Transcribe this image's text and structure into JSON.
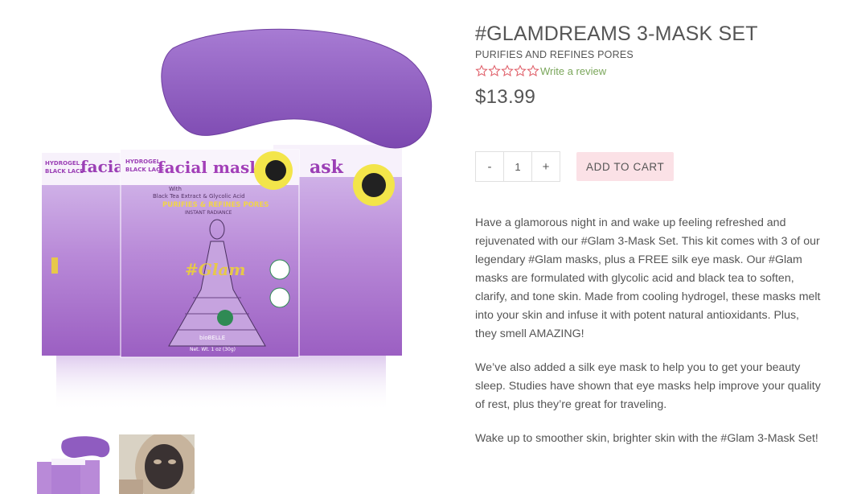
{
  "product": {
    "title": "#GLAMDREAMS 3-MASK SET",
    "subtitle": "PURIFIES AND REFINES PORES",
    "rating": {
      "stars": 0,
      "max": 5,
      "review_link": "Write a review"
    },
    "price": "$13.99",
    "quantity": "1",
    "qty_minus": "-",
    "qty_plus": "+",
    "add_to_cart": "ADD TO CART",
    "description": [
      "Have a glamorous night in and wake up feeling refreshed and rejuvenated with our #Glam 3-Mask Set. This kit comes with 3 of our legendary #Glam masks, plus a FREE silk eye mask. Our #Glam masks are formulated with glycolic acid and black tea to soften, clarify, and tone skin. Made from cooling hydrogel, these masks melt into your skin and infuse it with potent natural antioxidants. Plus, they smell AMAZING!",
      "We’ve also added a silk eye mask to help you to get your beauty sleep. Studies have shown that eye masks help improve your quality of rest, plus they’re great for traveling.",
      "Wake up to smoother skin, brighter skin with the #Glam 3-Mask Set!"
    ]
  },
  "image": {
    "pack_top_left": "HYDROGEL",
    "pack_top_left_2": "BLACK LACE",
    "pack_headline": "facial mask",
    "pack_with": "With",
    "pack_ingredients": "Black Tea Extract & Glycolic Acid",
    "pack_claim": "PURIFIES & REFINES PORES",
    "pack_tagline": "INSTANT RADIANCE",
    "pack_brand_script": "#Glam",
    "pack_brand": "bioBELLE",
    "pack_net": "Net. Wt. 1 oz (30g)"
  },
  "colors": {
    "accent_green": "#7aa65a",
    "star_red": "#e0606a",
    "cart_bg": "#fbe1e6",
    "pack_purple": "#9b5fc2",
    "mask_purple": "#8f5cc0"
  }
}
